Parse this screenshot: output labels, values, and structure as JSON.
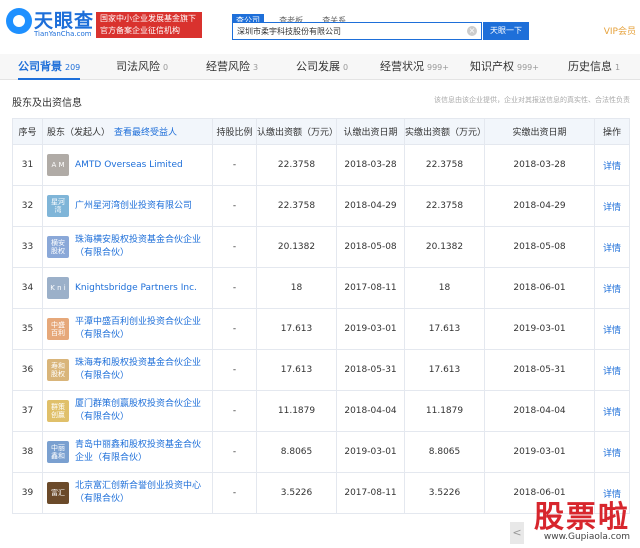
{
  "header": {
    "logo_text": "天眼查",
    "logo_sub": "TianYanCha.com",
    "banner": "国家中小企业发展基金旗下 官方备案企业征信机构",
    "search_tabs": [
      "查公司",
      "查老板",
      "查关系"
    ],
    "search_value": "深圳市柔宇科技股份有限公司",
    "search_button": "天眼一下",
    "vip_label": "VIP会员"
  },
  "nav": [
    {
      "label": "公司背景",
      "count": "209"
    },
    {
      "label": "司法风险",
      "count": "0"
    },
    {
      "label": "经营风险",
      "count": "3"
    },
    {
      "label": "公司发展",
      "count": "0"
    },
    {
      "label": "经营状况",
      "count": "999+"
    },
    {
      "label": "知识产权",
      "count": "999+"
    },
    {
      "label": "历史信息",
      "count": "1"
    }
  ],
  "section": {
    "title": "股东及出资信息",
    "disclaimer": "该信息由该企业提供，企业对其报送信息的真实性、合法性负责"
  },
  "table": {
    "headers": {
      "index": "序号",
      "holder": "股东（发起人）",
      "holder_link": "查看最终受益人",
      "ratio": "持股比例",
      "subscribed_amount": "认缴出资额（万元）",
      "subscribed_date": "认缴出资日期",
      "paid_amount": "实缴出资额（万元）",
      "paid_date": "实缴出资日期",
      "action": "操作"
    },
    "rows": [
      {
        "index": "31",
        "logo": "A M",
        "logo_color": "#b0aba6",
        "name": "AMTD Overseas Limited",
        "ratio": "-",
        "sub_amt": "22.3758",
        "sub_date": "2018-03-28",
        "paid_amt": "22.3758",
        "paid_date": "2018-03-28",
        "action": "详情"
      },
      {
        "index": "32",
        "logo": "星河湾",
        "logo_color": "#7fb5d8",
        "name": "广州星河湾创业投资有限公司",
        "ratio": "-",
        "sub_amt": "22.3758",
        "sub_date": "2018-04-29",
        "paid_amt": "22.3758",
        "paid_date": "2018-04-29",
        "action": "详情"
      },
      {
        "index": "33",
        "logo": "横安股权",
        "logo_color": "#8aa8d8",
        "name": "珠海横安股权投资基金合伙企业（有限合伙）",
        "ratio": "-",
        "sub_amt": "20.1382",
        "sub_date": "2018-05-08",
        "paid_amt": "20.1382",
        "paid_date": "2018-05-08",
        "action": "详情"
      },
      {
        "index": "34",
        "logo": "K n i",
        "logo_color": "#9bb0c9",
        "name": "Knightsbridge Partners Inc.",
        "ratio": "-",
        "sub_amt": "18",
        "sub_date": "2017-08-11",
        "paid_amt": "18",
        "paid_date": "2018-06-01",
        "action": "详情"
      },
      {
        "index": "35",
        "logo": "中盛百利",
        "logo_color": "#e6a87a",
        "name": "平潭中盛百利创业投资合伙企业（有限合伙）",
        "ratio": "-",
        "sub_amt": "17.613",
        "sub_date": "2019-03-01",
        "paid_amt": "17.613",
        "paid_date": "2019-03-01",
        "action": "详情"
      },
      {
        "index": "36",
        "logo": "寿和股权",
        "logo_color": "#d9b57a",
        "name": "珠海寿和股权投资基金合伙企业（有限合伙）",
        "ratio": "-",
        "sub_amt": "17.613",
        "sub_date": "2018-05-31",
        "paid_amt": "17.613",
        "paid_date": "2018-05-31",
        "action": "详情"
      },
      {
        "index": "37",
        "logo": "群策创赢",
        "logo_color": "#e0c06a",
        "name": "厦门群策创赢股权投资合伙企业（有限合伙）",
        "ratio": "-",
        "sub_amt": "11.1879",
        "sub_date": "2018-04-04",
        "paid_amt": "11.1879",
        "paid_date": "2018-04-04",
        "action": "详情"
      },
      {
        "index": "38",
        "logo": "中丽鑫和",
        "logo_color": "#7aa0d0",
        "name": "青岛中丽鑫和股权投资基金合伙企业（有限合伙）",
        "ratio": "-",
        "sub_amt": "8.8065",
        "sub_date": "2019-03-01",
        "paid_amt": "8.8065",
        "paid_date": "2019-03-01",
        "action": "详情"
      },
      {
        "index": "39",
        "logo": "富汇",
        "logo_color": "#6b4a2a",
        "name": "北京富汇创新合誉创业投资中心（有限合伙）",
        "ratio": "-",
        "sub_amt": "3.5226",
        "sub_date": "2017-08-11",
        "paid_amt": "3.5226",
        "paid_date": "2018-06-01",
        "action": "详情"
      }
    ]
  },
  "watermark": {
    "big": "股票啦",
    "url": "www.Gupiaola.com"
  },
  "sidebar_arrow": "<"
}
